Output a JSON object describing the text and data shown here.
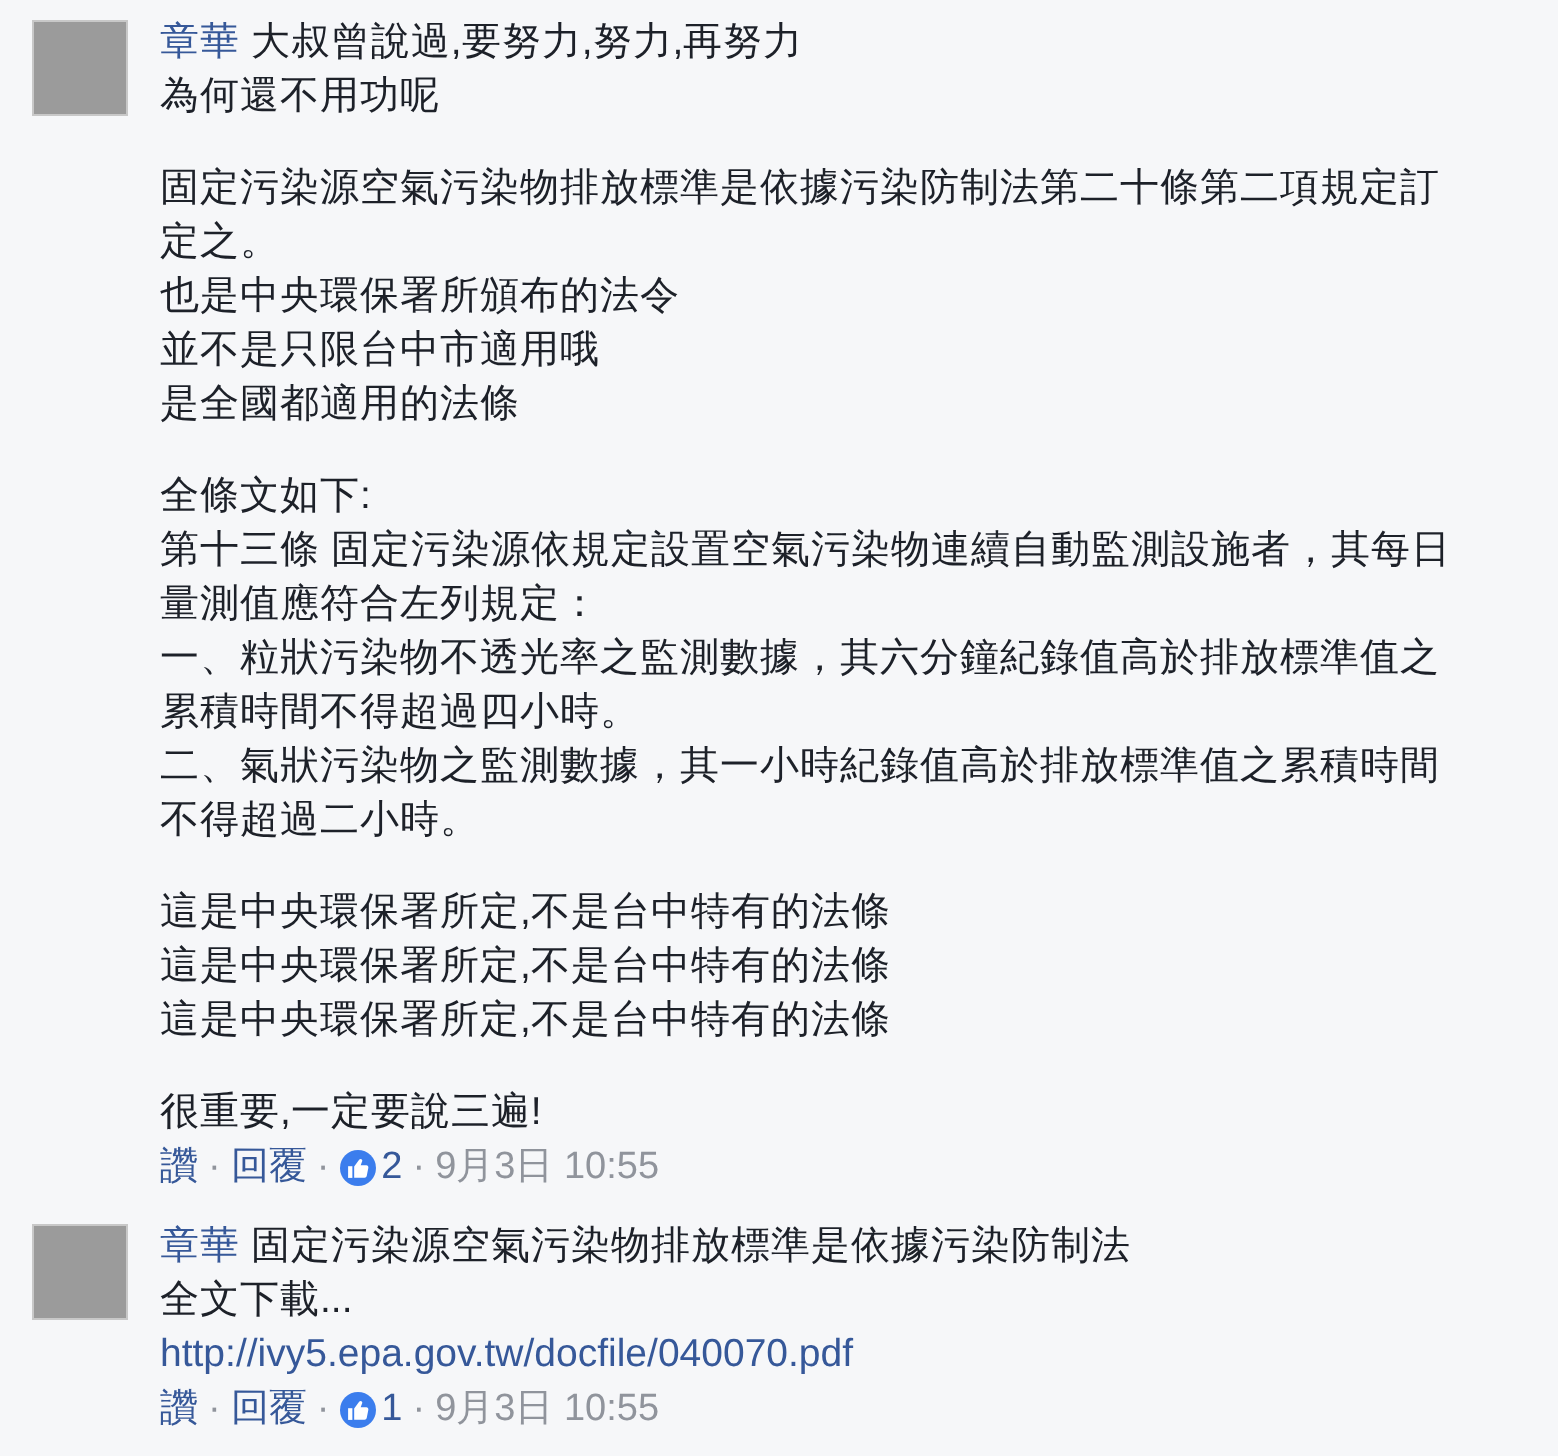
{
  "comments": [
    {
      "author": "章華",
      "paragraphs": [
        [
          "大叔曾說過,要努力,努力,再努力",
          "為何還不用功呢"
        ],
        [
          "固定污染源空氣污染物排放標準是依據污染防制法第二十條第二項規定訂",
          "定之。",
          "也是中央環保署所頒布的法令",
          "並不是只限台中市適用哦",
          "是全國都適用的法條"
        ],
        [
          "全條文如下:",
          "第十三條 固定污染源依規定設置空氣污染物連續自動監測設施者，其每日",
          "量測值應符合左列規定：",
          "一、粒狀污染物不透光率之監測數據，其六分鐘紀錄值高於排放標準值之",
          "累積時間不得超過四小時。",
          "二、氣狀污染物之監測數據，其一小時紀錄值高於排放標準值之累積時間",
          "不得超過二小時。"
        ],
        [
          "這是中央環保署所定,不是台中特有的法條",
          "這是中央環保署所定,不是台中特有的法條",
          "這是中央環保署所定,不是台中特有的法條"
        ],
        [
          "很重要,一定要說三遍!"
        ]
      ],
      "actions": [
        {
          "kind": "like",
          "text": "讚"
        },
        {
          "kind": "separator",
          "text": "·"
        },
        {
          "kind": "reply",
          "text": "回覆"
        },
        {
          "kind": "separator",
          "text": "·"
        },
        {
          "kind": "reactions",
          "count": "2"
        },
        {
          "kind": "separator",
          "text": "·"
        },
        {
          "kind": "timestamp",
          "text": "9月3日 10:55"
        }
      ]
    },
    {
      "author": "章華",
      "paragraphs": [
        [
          "固定污染源空氣污染物排放標準是依據污染防制法",
          "全文下載..."
        ]
      ],
      "link": "http://ivy5.epa.gov.tw/docfile/040070.pdf",
      "actions": [
        {
          "kind": "like",
          "text": "讚"
        },
        {
          "kind": "separator",
          "text": "·"
        },
        {
          "kind": "reply",
          "text": "回覆"
        },
        {
          "kind": "separator",
          "text": "·"
        },
        {
          "kind": "reactions",
          "count": "1"
        },
        {
          "kind": "separator",
          "text": "·"
        },
        {
          "kind": "timestamp",
          "text": "9月3日 10:55"
        }
      ]
    }
  ]
}
